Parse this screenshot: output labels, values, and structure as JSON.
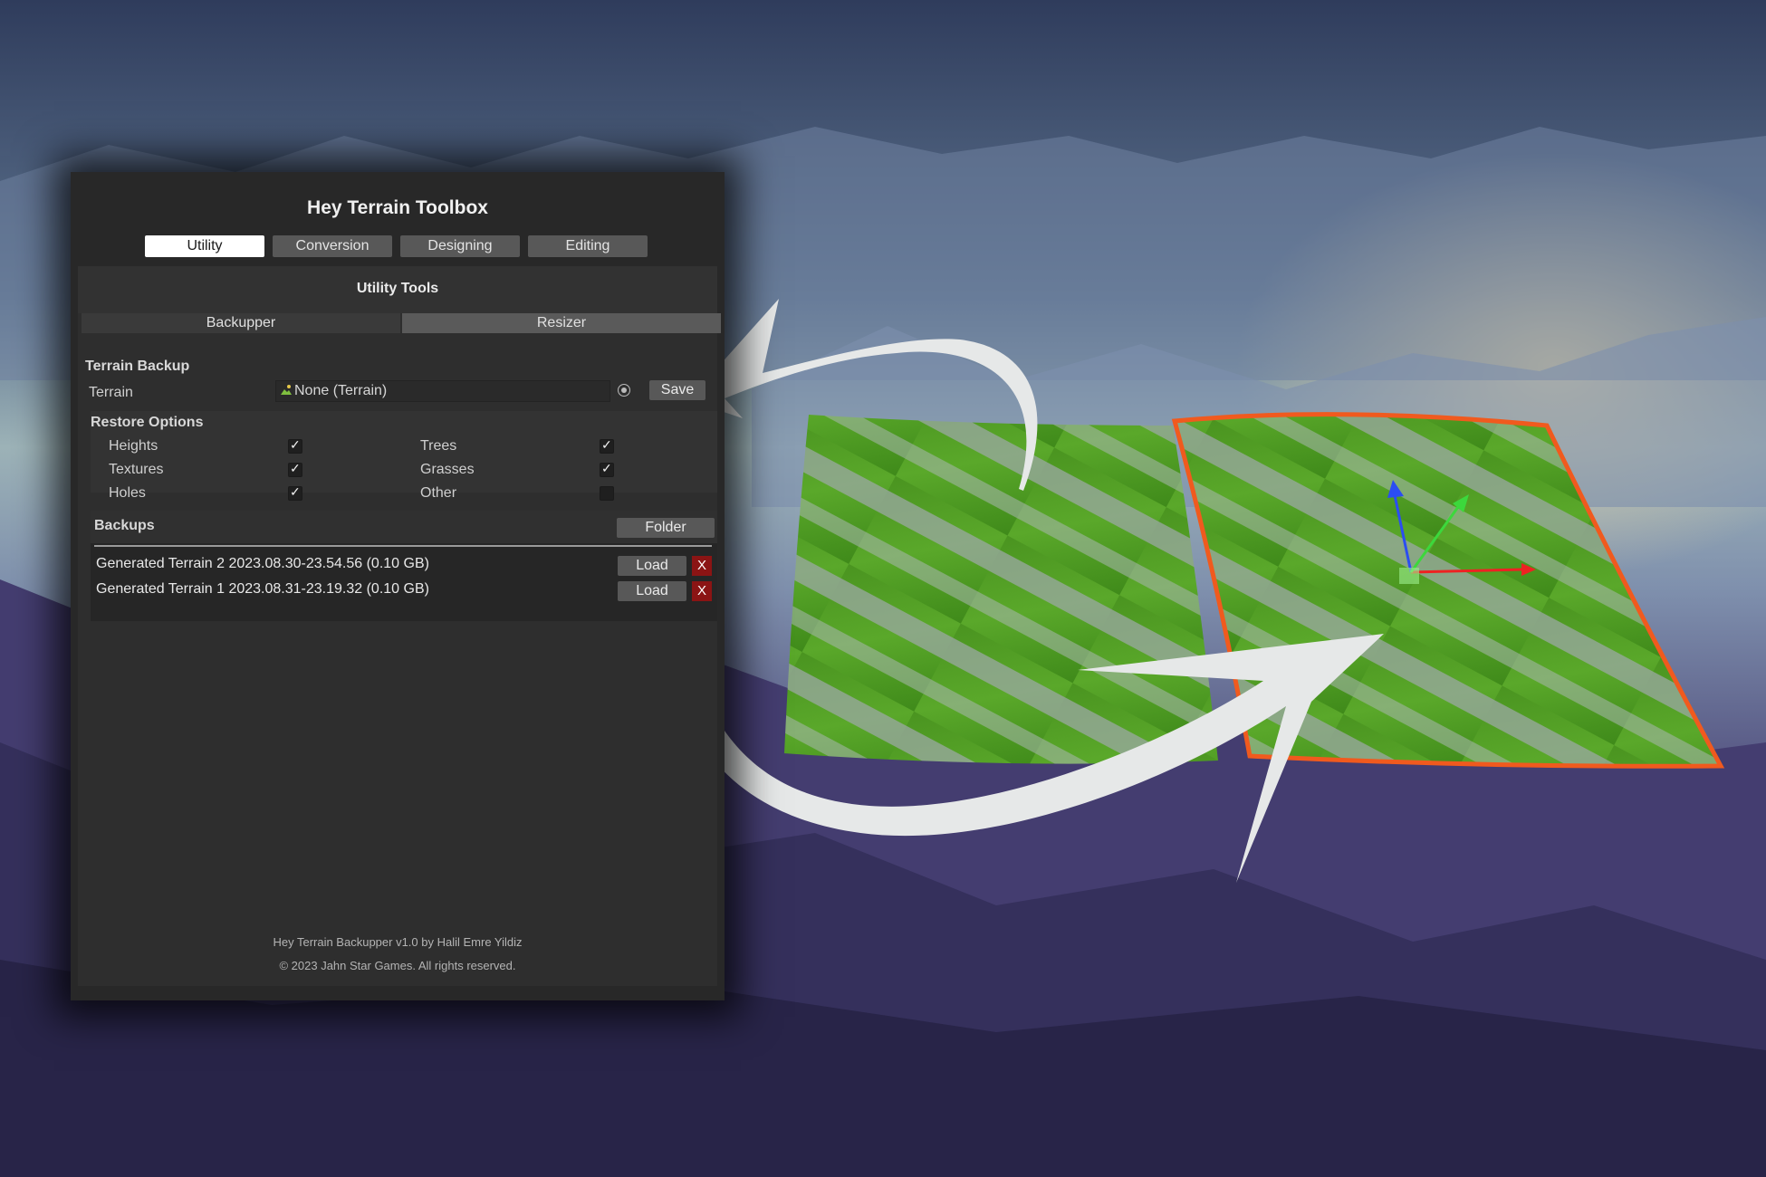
{
  "window": {
    "title": "Hey Terrain Toolbox"
  },
  "tabs": [
    {
      "label": "Utility",
      "active": true
    },
    {
      "label": "Conversion",
      "active": false
    },
    {
      "label": "Designing",
      "active": false
    },
    {
      "label": "Editing",
      "active": false
    }
  ],
  "panel": {
    "title": "Utility Tools"
  },
  "subtabs": [
    {
      "label": "Backupper"
    },
    {
      "label": "Resizer"
    }
  ],
  "terrain_backup": {
    "section_label": "Terrain Backup",
    "field_label": "Terrain",
    "field_value": "None (Terrain)",
    "save_label": "Save"
  },
  "restore_options": {
    "section_label": "Restore Options",
    "options": [
      {
        "label": "Heights",
        "checked": true
      },
      {
        "label": "Trees",
        "checked": true
      },
      {
        "label": "Textures",
        "checked": true
      },
      {
        "label": "Grasses",
        "checked": true
      },
      {
        "label": "Holes",
        "checked": true
      },
      {
        "label": "Other",
        "checked": false
      }
    ]
  },
  "backups": {
    "section_label": "Backups",
    "folder_label": "Folder",
    "load_label": "Load",
    "delete_label": "X",
    "items": [
      {
        "name": "Generated Terrain 2 2023.08.30-23.54.56 (0.10 GB)"
      },
      {
        "name": "Generated Terrain 1 2023.08.31-23.19.32 (0.10 GB)"
      }
    ]
  },
  "footer": {
    "line1": "Hey Terrain Backupper v1.0 by Halil Emre Yildiz",
    "line2": "© 2023 Jahn Star Games. All rights reserved."
  },
  "colors": {
    "sky_top": "#3a4766",
    "sky_mid": "#8fa6b4",
    "mountains": "#3b3560",
    "terrain_green": "#4f9a1f",
    "selection_outline": "#f05a1e",
    "arrow": "#e6e8e8"
  }
}
